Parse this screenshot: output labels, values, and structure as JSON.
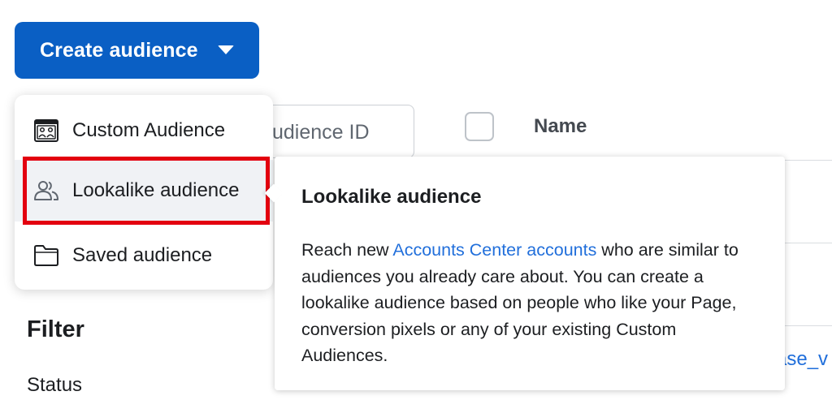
{
  "create_button": {
    "label": "Create audience"
  },
  "search": {
    "placeholder_visible": "udience ID"
  },
  "table": {
    "column_name": "Name",
    "partial_link": "ase_v"
  },
  "filter": {
    "title": "Filter",
    "status_label": "Status"
  },
  "menu": {
    "items": [
      {
        "label": "Custom Audience",
        "icon": "custom-audience-icon"
      },
      {
        "label": "Lookalike audience",
        "icon": "people-icon",
        "selected": true
      },
      {
        "label": "Saved audience",
        "icon": "folder-icon"
      }
    ]
  },
  "tooltip": {
    "title": "Lookalike audience",
    "body_before": "Reach new ",
    "link": "Accounts Center accounts",
    "body_after": " who are similar to audiences you already care about. You can create a lookalike audience based on people who like your Page, conversion pixels or any of your existing Custom Audiences."
  },
  "colors": {
    "primary_button": "#0a5fc4",
    "link": "#216fdb",
    "highlight_border": "#e3000f",
    "selected_item_bg": "#f0f2f5"
  }
}
